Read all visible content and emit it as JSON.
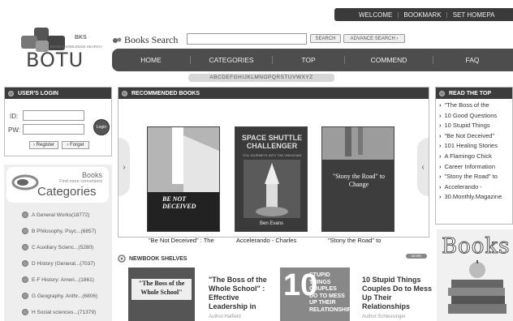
{
  "topbar": {
    "welcome": "WELCOME",
    "bookmark": "BOOKMARK",
    "set_homepage": "SET HOMEPA"
  },
  "logo": {
    "bks": "BKS",
    "tagline": "BOOK KNOWLEDGE SEARCH",
    "word": "BOTU"
  },
  "search": {
    "label": "Books Search",
    "value": "",
    "search_button": "SEARCH",
    "advanced_button": "ADVANCE SEARCH ›"
  },
  "nav": [
    "HOME",
    "CATEGORIES",
    "TOP",
    "COMMEND",
    "FAQ"
  ],
  "alphabet": "ABCDEFGHIJKLMNOPQRSTUVWXYZ",
  "login": {
    "title": "USER'S LOGIN",
    "id_label": "ID:",
    "pw_label": "PW:",
    "id_value": "",
    "pw_value": "",
    "login_button": "Login",
    "register": "› Register",
    "forget": "› Forget"
  },
  "categories": {
    "books": "Books",
    "sub": "Find more convenient",
    "title": "Categories",
    "items": [
      "A General Works(18772)",
      "B Philosophy. Psyc...(6857)",
      "C Auxiliary Scienc...(5280)",
      "D History (General...(7037)",
      "E-F History: Ameri...(1861)",
      "G Geography. Anthr...(6806)",
      "H Social sciences...(71379)"
    ]
  },
  "recommended": {
    "title": "RECOMMENDED BOOKS",
    "books": [
      {
        "caption": "\"Be Not Deceived\" : The",
        "cover_title": "BE NOT DECEIVED"
      },
      {
        "caption": "Accelerando - Charles",
        "cover_title": "SPACE SHUTTLE CHALLENGER",
        "cover_sub": "TEN JOURNEYS INTO THE UNKNOWN",
        "cover_author": "Ben Evans"
      },
      {
        "caption": "\"Stony the Road\" to",
        "cover_title": "\"Stony the Road\" to Change"
      }
    ]
  },
  "newbook": {
    "title": "NEWBOOK SHELVES",
    "more": "MORE",
    "books": [
      {
        "title": "\"The Boss of the Whole School\" : Effective Leadership in",
        "author": "Author:Hatfield",
        "cover_title": "\"The Boss of the Whole School\""
      },
      {
        "title": "10 Stupid Things Couples Do to Mess Up Their Relationships",
        "author": "Author:Schlessinger",
        "cover_num": "10",
        "cover_words": "STUPID THINGS COUPLES DO TO MESS UP THEIR RELATIONSHIPS"
      }
    ]
  },
  "read_top": {
    "title": "READ THE TOP",
    "items": [
      "\"The Boss of the",
      "10 Good Questions",
      "10 Stupid Things",
      "\"Be Not Deceived\"",
      "101 Healing Stories",
      "A Flamingo Chick",
      "Career Information",
      "\"Stony the Road\" to",
      "Accelerando -",
      "30.Monthly.Magazine"
    ]
  },
  "ad": {
    "word": "Books"
  },
  "colors": {
    "header_dark": "#3c3c3c",
    "nav": "#4d4d4d"
  }
}
